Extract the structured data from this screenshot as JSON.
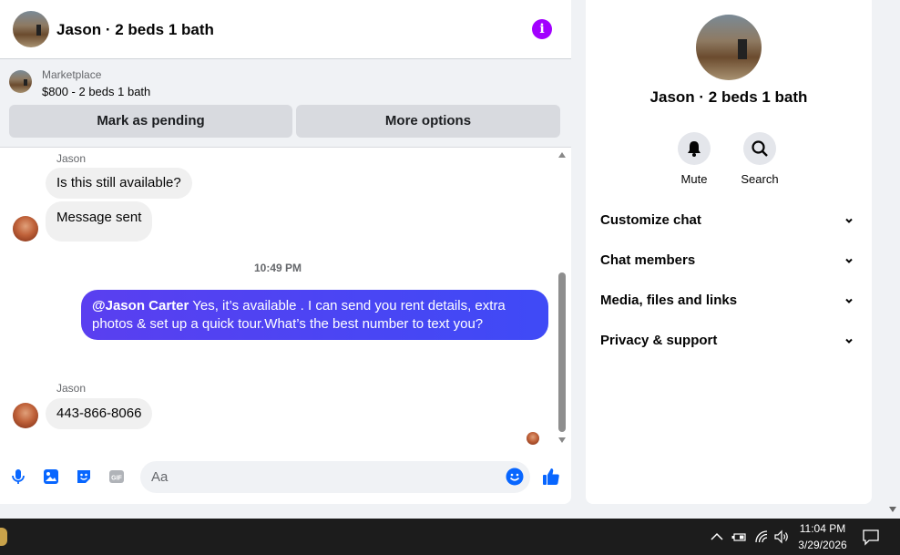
{
  "header": {
    "title": "Jason · 2 beds 1 bath"
  },
  "marketplace": {
    "label": "Marketplace",
    "listing": "$800 - 2 beds 1 bath",
    "pending_button": "Mark as pending",
    "more_button": "More options"
  },
  "messages": {
    "sender1": "Jason",
    "msg1": "Is this still available?",
    "msg2": "Message sent",
    "timestamp": "10:49 PM",
    "outgoing_mention": "@Jason Carter",
    "outgoing_text": " Yes, it’s available .  I can send you rent details, extra photos & set up a quick tour.What’s the best number to text you?",
    "sender2": "Jason",
    "msg3": "443-866-8066"
  },
  "composer": {
    "placeholder": "Aa"
  },
  "sidebar": {
    "title": "Jason · 2 beds 1 bath",
    "actions": [
      {
        "label": "Mute",
        "icon": "bell-icon"
      },
      {
        "label": "Search",
        "icon": "search-icon"
      }
    ],
    "sections": [
      {
        "label": "Customize chat"
      },
      {
        "label": "Chat members"
      },
      {
        "label": "Media, files and links"
      },
      {
        "label": "Privacy & support"
      }
    ]
  },
  "taskbar": {
    "time": "11:04 PM",
    "date": "3/29/2026"
  },
  "colors": {
    "accent": "#0866ff",
    "info": "#a200ff",
    "outgoing_bubble": "#4a44f3"
  }
}
